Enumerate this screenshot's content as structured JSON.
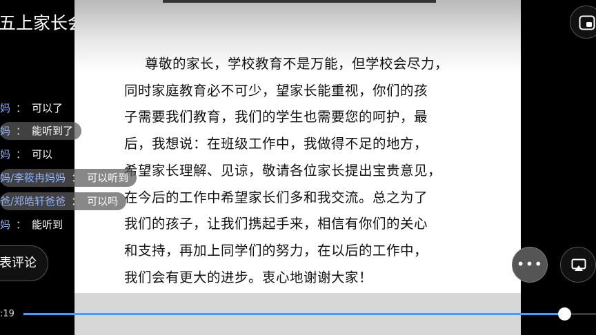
{
  "title": "五上家长会",
  "slide": {
    "lines": [
      "尊敬的家长，学校教育不是万能，但学校会尽力，",
      "同时家庭教育必不可少，望家长能重视，你们的孩",
      "子需要我们教育，我们的学生也需要您的呵护，最",
      "后，我想说：在班级工作中，我做得不足的地方，",
      "希望家长理解、见谅，敬请各位家长提出宝贵意见，",
      "在今后的工作中希望家长们多和我交流。总之为了",
      "我们的孩子，让我们携起手来，相信有你们的关心",
      "和支持，再加上同学们的努力，在以后的工作中，",
      "我们会有更大的进步。衷心地谢谢大家！"
    ]
  },
  "comments": [
    {
      "name": "妈",
      "sep": "：",
      "msg": "可以了"
    },
    {
      "name": "妈",
      "sep": "：",
      "msg": "能听到了"
    },
    {
      "name": "妈",
      "sep": "：",
      "msg": "可以"
    },
    {
      "name": "妈/李筱冉妈妈",
      "sep": "：",
      "msg": "可以听到"
    },
    {
      "name": "爸/郑皓轩爸爸",
      "sep": "：",
      "msg": "可以吗"
    },
    {
      "name": "妈",
      "sep": "：",
      "msg": "能听到"
    }
  ],
  "post_comment_label": "表评论",
  "more_label": "•••",
  "time_label": ":19",
  "progress": {
    "fraction": 0.944
  },
  "colors": {
    "accent": "#4f9bf0",
    "name": "#8fb4ff"
  },
  "icons": {
    "pip": "picture-in-picture-icon",
    "cast": "screen-cast-icon",
    "more": "more-horizontal-icon"
  }
}
